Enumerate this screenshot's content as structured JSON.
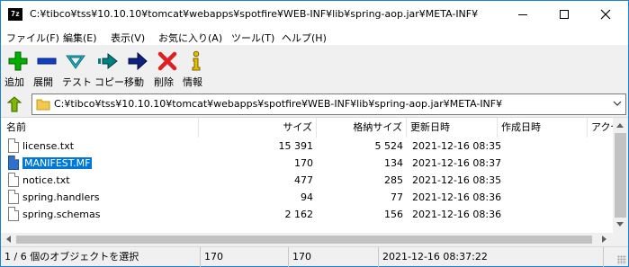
{
  "window": {
    "title": "C:¥tibco¥tss¥10.10.10¥tomcat¥webapps¥spotfire¥WEB-INF¥lib¥spring-aop.jar¥META-INF¥",
    "app_icon_text": "7z"
  },
  "menu": [
    "ファイル(F)",
    "編集(E)",
    "表示(V)",
    "お気に入り(A)",
    "ツール(T)",
    "ヘルプ(H)"
  ],
  "toolbar": [
    {
      "label": "追加",
      "icon": "add-icon",
      "color": "#00b000"
    },
    {
      "label": "展開",
      "icon": "extract-icon",
      "color": "#1040c0"
    },
    {
      "label": "テスト",
      "icon": "test-icon",
      "color": "#20b0c0"
    },
    {
      "label": "コピー",
      "icon": "copy-icon",
      "color": "#008080"
    },
    {
      "label": "移動",
      "icon": "move-icon",
      "color": "#102080"
    },
    {
      "label": "削除",
      "icon": "delete-icon",
      "color": "#e02020"
    },
    {
      "label": "情報",
      "icon": "info-icon",
      "color": "#c0a000"
    }
  ],
  "address": {
    "path": "C:¥tibco¥tss¥10.10.10¥tomcat¥webapps¥spotfire¥WEB-INF¥lib¥spring-aop.jar¥META-INF¥"
  },
  "columns": [
    "名前",
    "サイズ",
    "格納サイズ",
    "更新日時",
    "作成日時",
    "アクセ"
  ],
  "files": [
    {
      "name": "license.txt",
      "size": "15 391",
      "packed": "5 524",
      "modified": "2021-12-16 08:35",
      "selected": false
    },
    {
      "name": "MANIFEST.MF",
      "size": "170",
      "packed": "134",
      "modified": "2021-12-16 08:37",
      "selected": true
    },
    {
      "name": "notice.txt",
      "size": "477",
      "packed": "285",
      "modified": "2021-12-16 08:35",
      "selected": false
    },
    {
      "name": "spring.handlers",
      "size": "94",
      "packed": "77",
      "modified": "2021-12-16 08:36",
      "selected": false
    },
    {
      "name": "spring.schemas",
      "size": "2 162",
      "packed": "156",
      "modified": "2021-12-16 08:36",
      "selected": false
    }
  ],
  "status": {
    "selection": "1 / 6 個のオブジェクトを選択",
    "size": "170",
    "packed": "170",
    "modified": "2021-12-16 08:37:22"
  },
  "colors": {
    "selection": "#0078d7",
    "window_border": "#1883d7"
  }
}
